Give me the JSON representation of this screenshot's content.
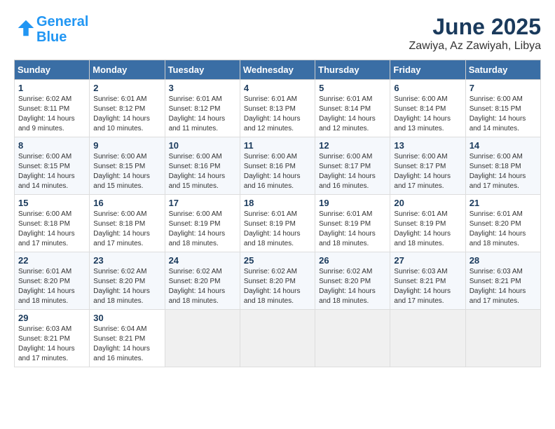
{
  "header": {
    "logo_line1": "General",
    "logo_line2": "Blue",
    "title": "June 2025",
    "subtitle": "Zawiya, Az Zawiyah, Libya"
  },
  "days_of_week": [
    "Sunday",
    "Monday",
    "Tuesday",
    "Wednesday",
    "Thursday",
    "Friday",
    "Saturday"
  ],
  "weeks": [
    [
      {
        "day": "1",
        "info": "Sunrise: 6:02 AM\nSunset: 8:11 PM\nDaylight: 14 hours\nand 9 minutes."
      },
      {
        "day": "2",
        "info": "Sunrise: 6:01 AM\nSunset: 8:12 PM\nDaylight: 14 hours\nand 10 minutes."
      },
      {
        "day": "3",
        "info": "Sunrise: 6:01 AM\nSunset: 8:12 PM\nDaylight: 14 hours\nand 11 minutes."
      },
      {
        "day": "4",
        "info": "Sunrise: 6:01 AM\nSunset: 8:13 PM\nDaylight: 14 hours\nand 12 minutes."
      },
      {
        "day": "5",
        "info": "Sunrise: 6:01 AM\nSunset: 8:14 PM\nDaylight: 14 hours\nand 12 minutes."
      },
      {
        "day": "6",
        "info": "Sunrise: 6:00 AM\nSunset: 8:14 PM\nDaylight: 14 hours\nand 13 minutes."
      },
      {
        "day": "7",
        "info": "Sunrise: 6:00 AM\nSunset: 8:15 PM\nDaylight: 14 hours\nand 14 minutes."
      }
    ],
    [
      {
        "day": "8",
        "info": "Sunrise: 6:00 AM\nSunset: 8:15 PM\nDaylight: 14 hours\nand 14 minutes."
      },
      {
        "day": "9",
        "info": "Sunrise: 6:00 AM\nSunset: 8:15 PM\nDaylight: 14 hours\nand 15 minutes."
      },
      {
        "day": "10",
        "info": "Sunrise: 6:00 AM\nSunset: 8:16 PM\nDaylight: 14 hours\nand 15 minutes."
      },
      {
        "day": "11",
        "info": "Sunrise: 6:00 AM\nSunset: 8:16 PM\nDaylight: 14 hours\nand 16 minutes."
      },
      {
        "day": "12",
        "info": "Sunrise: 6:00 AM\nSunset: 8:17 PM\nDaylight: 14 hours\nand 16 minutes."
      },
      {
        "day": "13",
        "info": "Sunrise: 6:00 AM\nSunset: 8:17 PM\nDaylight: 14 hours\nand 17 minutes."
      },
      {
        "day": "14",
        "info": "Sunrise: 6:00 AM\nSunset: 8:18 PM\nDaylight: 14 hours\nand 17 minutes."
      }
    ],
    [
      {
        "day": "15",
        "info": "Sunrise: 6:00 AM\nSunset: 8:18 PM\nDaylight: 14 hours\nand 17 minutes."
      },
      {
        "day": "16",
        "info": "Sunrise: 6:00 AM\nSunset: 8:18 PM\nDaylight: 14 hours\nand 17 minutes."
      },
      {
        "day": "17",
        "info": "Sunrise: 6:00 AM\nSunset: 8:19 PM\nDaylight: 14 hours\nand 18 minutes."
      },
      {
        "day": "18",
        "info": "Sunrise: 6:01 AM\nSunset: 8:19 PM\nDaylight: 14 hours\nand 18 minutes."
      },
      {
        "day": "19",
        "info": "Sunrise: 6:01 AM\nSunset: 8:19 PM\nDaylight: 14 hours\nand 18 minutes."
      },
      {
        "day": "20",
        "info": "Sunrise: 6:01 AM\nSunset: 8:19 PM\nDaylight: 14 hours\nand 18 minutes."
      },
      {
        "day": "21",
        "info": "Sunrise: 6:01 AM\nSunset: 8:20 PM\nDaylight: 14 hours\nand 18 minutes."
      }
    ],
    [
      {
        "day": "22",
        "info": "Sunrise: 6:01 AM\nSunset: 8:20 PM\nDaylight: 14 hours\nand 18 minutes."
      },
      {
        "day": "23",
        "info": "Sunrise: 6:02 AM\nSunset: 8:20 PM\nDaylight: 14 hours\nand 18 minutes."
      },
      {
        "day": "24",
        "info": "Sunrise: 6:02 AM\nSunset: 8:20 PM\nDaylight: 14 hours\nand 18 minutes."
      },
      {
        "day": "25",
        "info": "Sunrise: 6:02 AM\nSunset: 8:20 PM\nDaylight: 14 hours\nand 18 minutes."
      },
      {
        "day": "26",
        "info": "Sunrise: 6:02 AM\nSunset: 8:20 PM\nDaylight: 14 hours\nand 18 minutes."
      },
      {
        "day": "27",
        "info": "Sunrise: 6:03 AM\nSunset: 8:21 PM\nDaylight: 14 hours\nand 17 minutes."
      },
      {
        "day": "28",
        "info": "Sunrise: 6:03 AM\nSunset: 8:21 PM\nDaylight: 14 hours\nand 17 minutes."
      }
    ],
    [
      {
        "day": "29",
        "info": "Sunrise: 6:03 AM\nSunset: 8:21 PM\nDaylight: 14 hours\nand 17 minutes."
      },
      {
        "day": "30",
        "info": "Sunrise: 6:04 AM\nSunset: 8:21 PM\nDaylight: 14 hours\nand 16 minutes."
      },
      {
        "day": "",
        "info": ""
      },
      {
        "day": "",
        "info": ""
      },
      {
        "day": "",
        "info": ""
      },
      {
        "day": "",
        "info": ""
      },
      {
        "day": "",
        "info": ""
      }
    ]
  ]
}
